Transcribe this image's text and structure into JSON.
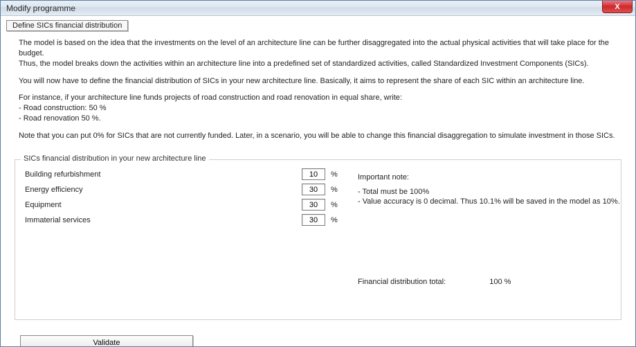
{
  "window": {
    "title": "Modify programme",
    "close_label": "X"
  },
  "tab": {
    "define_sics": "Define SICs financial distribution"
  },
  "description": {
    "p1a": "The model is based on the idea that the investments on the level of an architecture line can be further disaggregated into the actual physical activities that will take place for the budget.",
    "p1b": "Thus, the model breaks down the activities within an architecture line into a predefined set of standardized activities, called Standardized Investment Components (SICs).",
    "p2": "You will now have to define the financial distribution of SICs in your new architecture line. Basically, it aims to represent the share of each SIC within an architecture line.",
    "p3a": "For instance, if your architecture line funds projects of road construction and road renovation in equal share, write:",
    "p3b": "- Road construction: 50 %",
    "p3c": "- Road renovation  50 %.",
    "p4": "Note that  you can put 0% for SICs that are not currently funded. Later, in a scenario, you will be able to change this financial disaggregation to simulate investment in those SICs."
  },
  "fieldset": {
    "legend": "SICs financial distribution in your new architecture line",
    "rows": [
      {
        "label": "Building refurbishment",
        "value": "10"
      },
      {
        "label": "Energy efficiency",
        "value": "30"
      },
      {
        "label": "Equipment",
        "value": "30"
      },
      {
        "label": "Immaterial services",
        "value": "30"
      }
    ],
    "percent_sign": "%",
    "note_title": "Important note:",
    "note_line1": "- Total must be 100%",
    "note_line2": "- Value accuracy is 0 decimal. Thus 10.1% will be saved in the model as 10%.",
    "total_label": "Financial distribution total:",
    "total_value": "100 %"
  },
  "buttons": {
    "validate": "Validate"
  }
}
